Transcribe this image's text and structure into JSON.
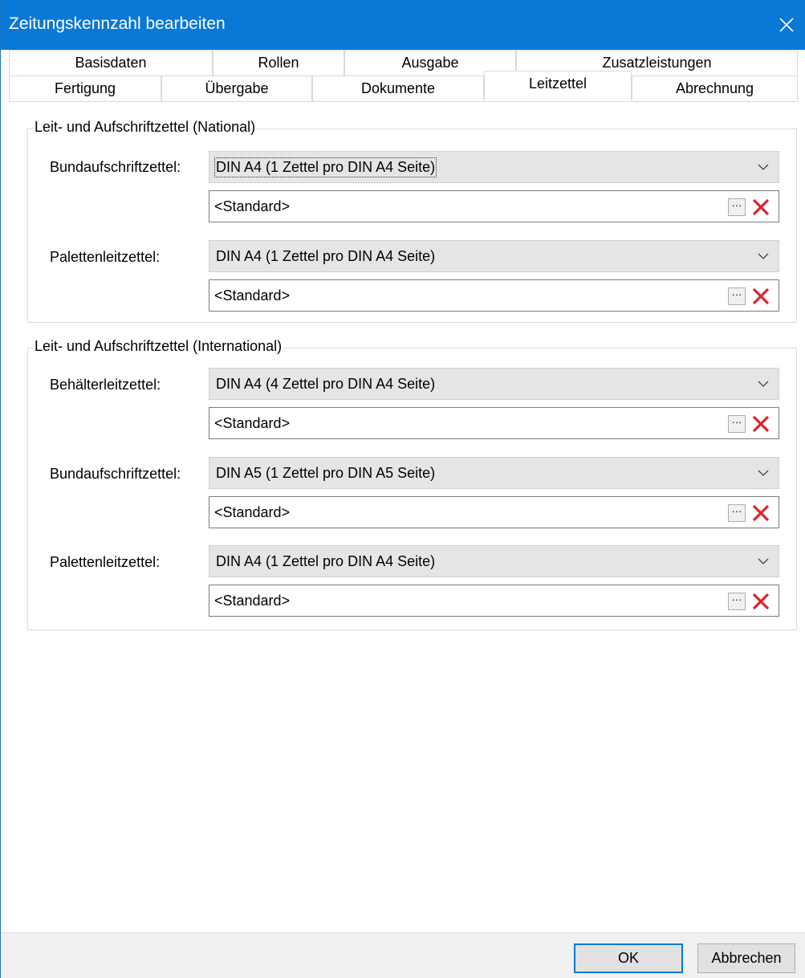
{
  "window": {
    "title": "Zeitungskennzahl bearbeiten"
  },
  "tabs": {
    "row1": [
      {
        "label": "Basisdaten"
      },
      {
        "label": "Rollen"
      },
      {
        "label": "Ausgabe"
      },
      {
        "label": "Zusatzleistungen"
      }
    ],
    "row2": [
      {
        "label": "Fertigung"
      },
      {
        "label": "Übergabe"
      },
      {
        "label": "Dokumente"
      },
      {
        "label": "Leitzettel"
      },
      {
        "label": "Abrechnung"
      }
    ],
    "active": "Leitzettel"
  },
  "national": {
    "legend": "Leit- und Aufschriftzettel (National)",
    "fields": [
      {
        "label": "Bundaufschriftzettel:",
        "select_value": "DIN A4 (1 Zettel pro DIN A4 Seite)",
        "text_value": "<Standard>"
      },
      {
        "label": "Palettenleitzettel:",
        "select_value": "DIN A4 (1 Zettel pro DIN A4 Seite)",
        "text_value": "<Standard>"
      }
    ]
  },
  "international": {
    "legend": "Leit- und Aufschriftzettel (International)",
    "fields": [
      {
        "label": "Behälterleitzettel:",
        "select_value": "DIN A4 (4 Zettel pro DIN A4 Seite)",
        "text_value": "<Standard>"
      },
      {
        "label": "Bundaufschriftzettel:",
        "select_value": "DIN A5 (1 Zettel pro DIN A5 Seite)",
        "text_value": "<Standard>"
      },
      {
        "label": "Palettenleitzettel:",
        "select_value": "DIN A4 (1 Zettel pro DIN A4 Seite)",
        "text_value": "<Standard>"
      }
    ]
  },
  "buttons": {
    "ellipsis": "···",
    "ok": "OK",
    "cancel": "Abbrechen"
  },
  "colors": {
    "titlebar": "#0a78d7",
    "clear_icon": "#d9262c",
    "default_button_border": "#0078d7"
  },
  "icons": {
    "close": "close-icon",
    "dropdown": "chevron-down-icon",
    "clear": "delete-x-icon"
  }
}
